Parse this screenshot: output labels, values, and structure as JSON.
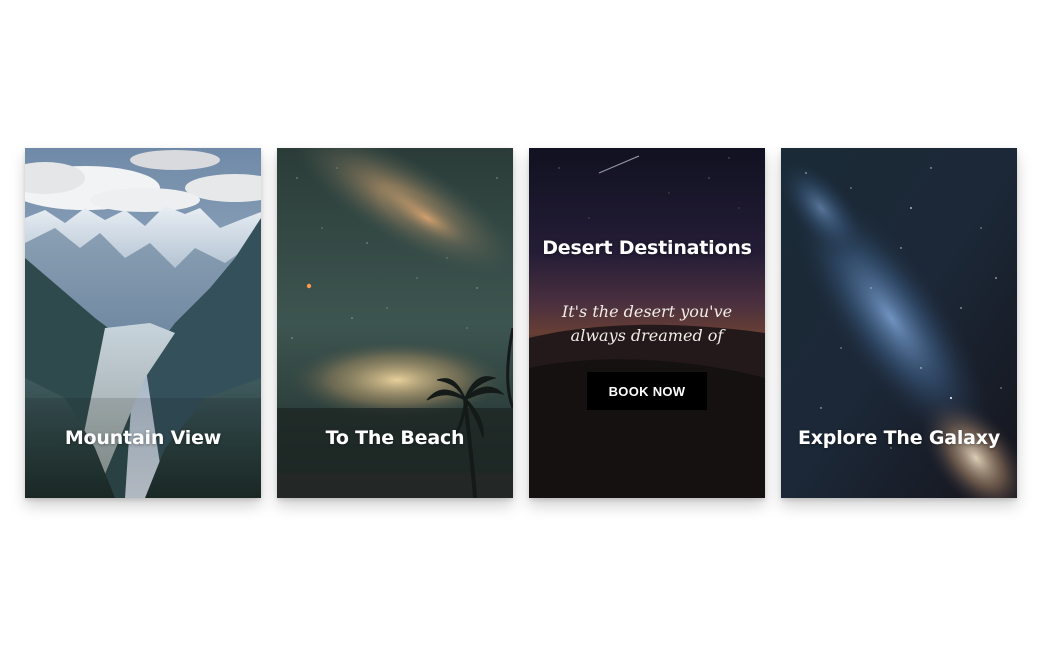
{
  "cards": [
    {
      "title": "Mountain View",
      "image": "snowy-mountain-valley-glacier-photo"
    },
    {
      "title": "To The Beach",
      "image": "night-sky-milky-way-palm-tree-photo"
    },
    {
      "title": "Desert Destinations",
      "description": "It's the desert you've always dreamed of",
      "button_label": "BOOK NOW",
      "image": "desert-dunes-at-dusk-photo"
    },
    {
      "title": "Explore The Galaxy",
      "image": "starry-galaxy-photo"
    }
  ],
  "colors": {
    "button_bg": "#000000",
    "text": "#ffffff",
    "page_bg": "#ffffff"
  }
}
